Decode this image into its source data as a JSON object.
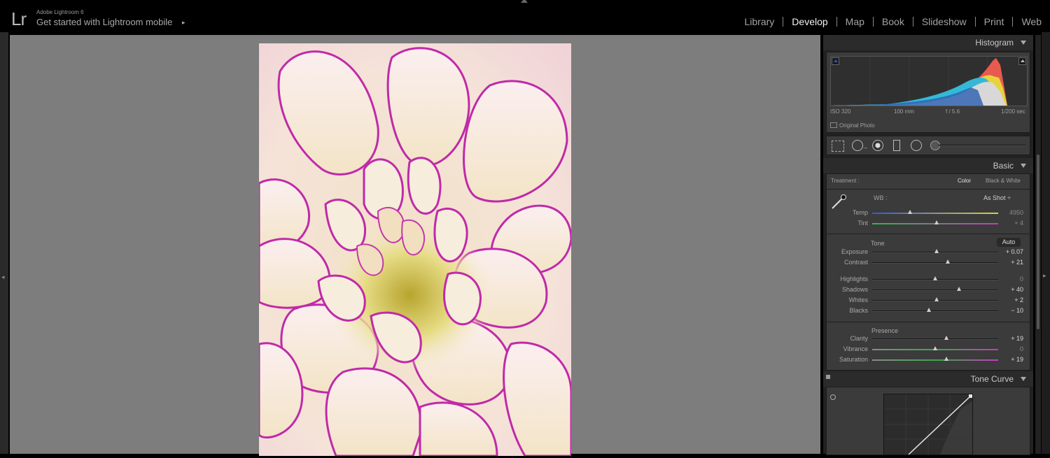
{
  "app": {
    "logo": "Lr",
    "product": "Adobe Lightroom 6",
    "promo": "Get started with Lightroom mobile",
    "promo_arrow": "▸"
  },
  "modules": [
    {
      "label": "Library",
      "active": false
    },
    {
      "label": "Develop",
      "active": true
    },
    {
      "label": "Map",
      "active": false
    },
    {
      "label": "Book",
      "active": false
    },
    {
      "label": "Slideshow",
      "active": false
    },
    {
      "label": "Print",
      "active": false
    },
    {
      "label": "Web",
      "active": false
    }
  ],
  "histogram": {
    "title": "Histogram",
    "iso": "ISO 320",
    "focal": "100 mm",
    "aperture": "f / 5.6",
    "shutter": "1/200 sec",
    "original_photo": "Original Photo"
  },
  "tools": [
    "crop-overlay-icon",
    "spot-removal-icon",
    "red-eye-icon",
    "graduated-filter-icon",
    "radial-filter-icon",
    "adjustment-brush-icon"
  ],
  "basic": {
    "title": "Basic",
    "treatment_label": "Treatment :",
    "treatment_color": "Color",
    "treatment_bw": "Black & White",
    "wb_label": "WB :",
    "wb_value": "As Shot ÷",
    "tone_label": "Tone",
    "auto_label": "Auto",
    "presence_label": "Presence",
    "sliders": {
      "temp": {
        "label": "Temp",
        "value": "4950",
        "level": 0.3
      },
      "tint": {
        "label": "Tint",
        "value": "+ 4",
        "level": 0.51
      },
      "exposure": {
        "label": "Exposure",
        "value": "+ 0.07",
        "level": 0.51
      },
      "contrast": {
        "label": "Contrast",
        "value": "+ 21",
        "level": 0.6
      },
      "highlights": {
        "label": "Highlights",
        "value": "0",
        "level": 0.5
      },
      "shadows": {
        "label": "Shadows",
        "value": "+ 40",
        "level": 0.69
      },
      "whites": {
        "label": "Whites",
        "value": "+ 2",
        "level": 0.51
      },
      "blacks": {
        "label": "Blacks",
        "value": "− 10",
        "level": 0.45
      },
      "clarity": {
        "label": "Clarity",
        "value": "+ 19",
        "level": 0.59
      },
      "vibrance": {
        "label": "Vibrance",
        "value": "0",
        "level": 0.5
      },
      "saturation": {
        "label": "Saturation",
        "value": "+ 19",
        "level": 0.59
      }
    }
  },
  "tone_curve": {
    "title": "Tone Curve"
  }
}
